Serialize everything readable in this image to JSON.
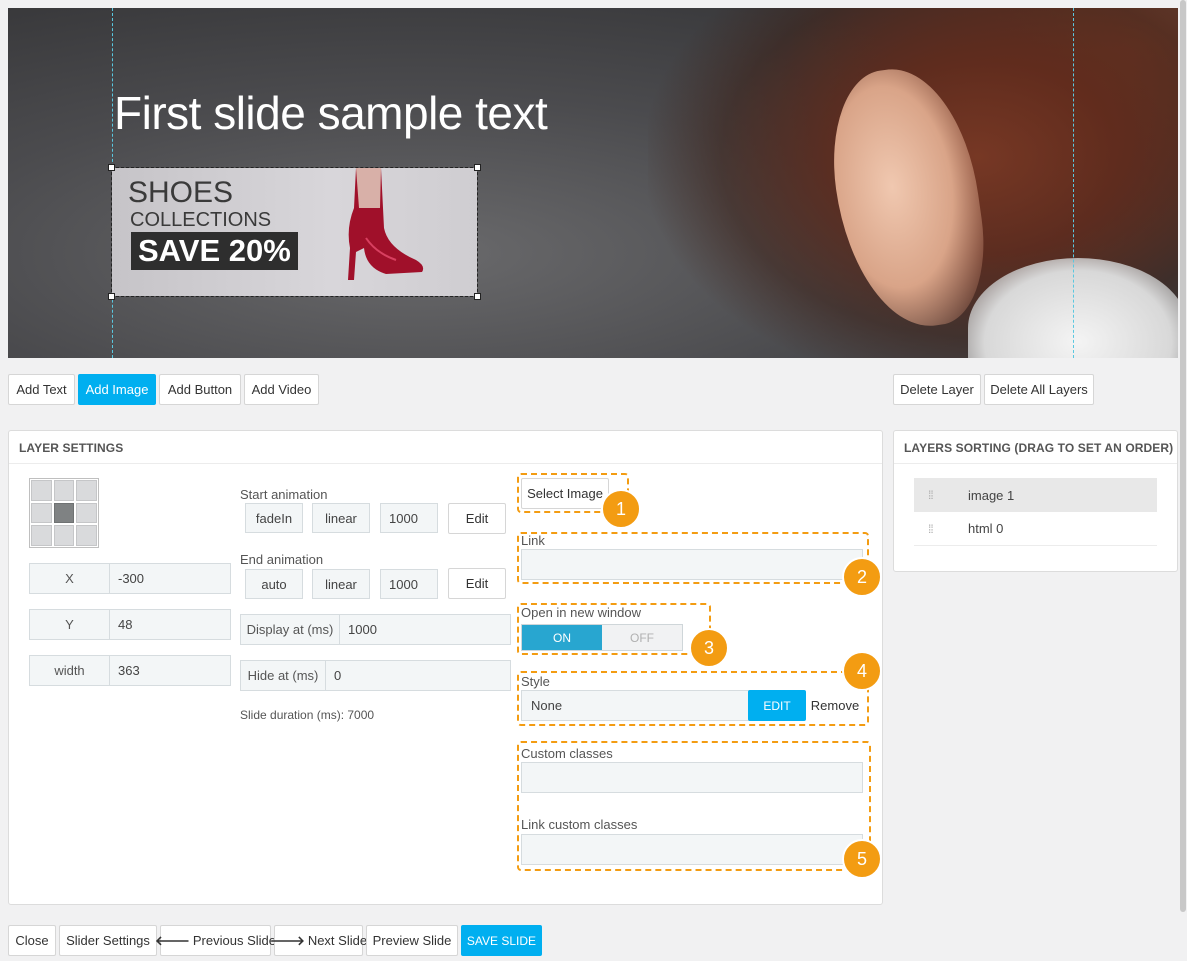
{
  "slide": {
    "title": "First slide sample text",
    "banner": {
      "shoes": "SHOES",
      "collections": "COLLECTIONS",
      "save": "SAVE 20%"
    }
  },
  "toolbar": {
    "add_text": "Add Text",
    "add_image": "Add Image",
    "add_button": "Add Button",
    "add_video": "Add Video",
    "delete_layer": "Delete Layer",
    "delete_all_layers": "Delete All Layers"
  },
  "layer_settings": {
    "title": "LAYER SETTINGS",
    "x_label": "X",
    "x_value": "-300",
    "y_label": "Y",
    "y_value": "48",
    "width_label": "width",
    "width_value": "363",
    "start_animation_label": "Start animation",
    "start_animation": {
      "effect": "fadeIn",
      "easing": "linear",
      "duration": "1000",
      "edit": "Edit"
    },
    "end_animation_label": "End animation",
    "end_animation": {
      "effect": "auto",
      "easing": "linear",
      "duration": "1000",
      "edit": "Edit"
    },
    "display_at_label": "Display at (ms)",
    "display_at_value": "1000",
    "hide_at_label": "Hide at (ms)",
    "hide_at_value": "0",
    "slide_duration": "Slide duration (ms): 7000",
    "select_image": "Select Image",
    "link_label": "Link",
    "link_value": "",
    "new_window_label": "Open in new window",
    "toggle_on": "ON",
    "toggle_off": "OFF",
    "style_label": "Style",
    "style_value": "None",
    "style_edit": "EDIT",
    "style_remove": "Remove",
    "custom_classes_label": "Custom classes",
    "custom_classes_value": "",
    "link_custom_classes_label": "Link custom classes",
    "link_custom_classes_value": ""
  },
  "annotations": [
    "1",
    "2",
    "3",
    "4",
    "5"
  ],
  "layers_sorting": {
    "title": "LAYERS SORTING (DRAG TO SET AN ORDER)",
    "items": [
      {
        "label": "image 1"
      },
      {
        "label": "html 0"
      }
    ]
  },
  "footer": {
    "close": "Close",
    "slider_settings": "Slider Settings",
    "previous_slide": "Previous Slide",
    "next_slide": "Next Slide",
    "preview_slide": "Preview Slide",
    "save_slide": "SAVE SLIDE"
  },
  "colors": {
    "accent": "#00aff0",
    "annotation": "#f39c12",
    "toggle_on": "#28a6d0"
  }
}
